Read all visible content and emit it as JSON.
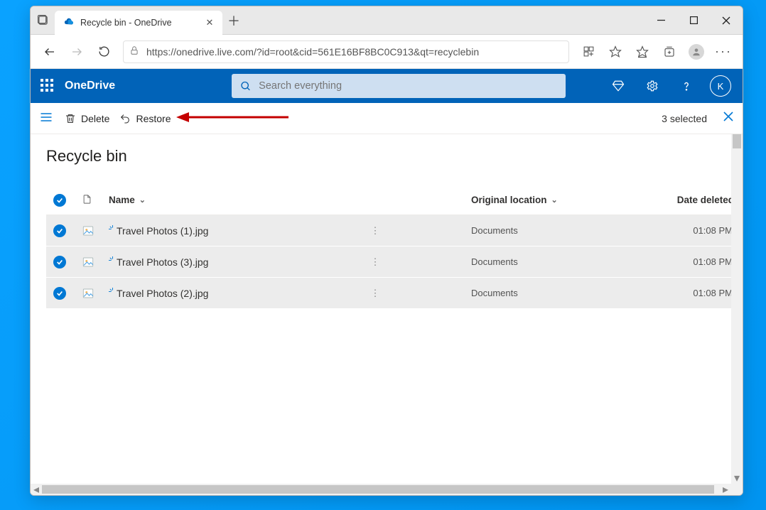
{
  "browser": {
    "tab_title": "Recycle bin - OneDrive",
    "url": "https://onedrive.live.com/?id=root&cid=561E16BF8BC0C913&qt=recyclebin"
  },
  "header": {
    "brand": "OneDrive",
    "search_placeholder": "Search everything",
    "avatar_initial": "K"
  },
  "commandbar": {
    "delete_label": "Delete",
    "restore_label": "Restore",
    "selected_label": "3 selected"
  },
  "page": {
    "title": "Recycle bin"
  },
  "columns": {
    "name": "Name",
    "location": "Original location",
    "deleted": "Date deleted"
  },
  "items": [
    {
      "name": "Travel Photos (1).jpg",
      "location": "Documents",
      "deleted": "01:08 PM",
      "selected": true
    },
    {
      "name": "Travel Photos (3).jpg",
      "location": "Documents",
      "deleted": "01:08 PM",
      "selected": true
    },
    {
      "name": "Travel Photos (2).jpg",
      "location": "Documents",
      "deleted": "01:08 PM",
      "selected": true
    }
  ]
}
